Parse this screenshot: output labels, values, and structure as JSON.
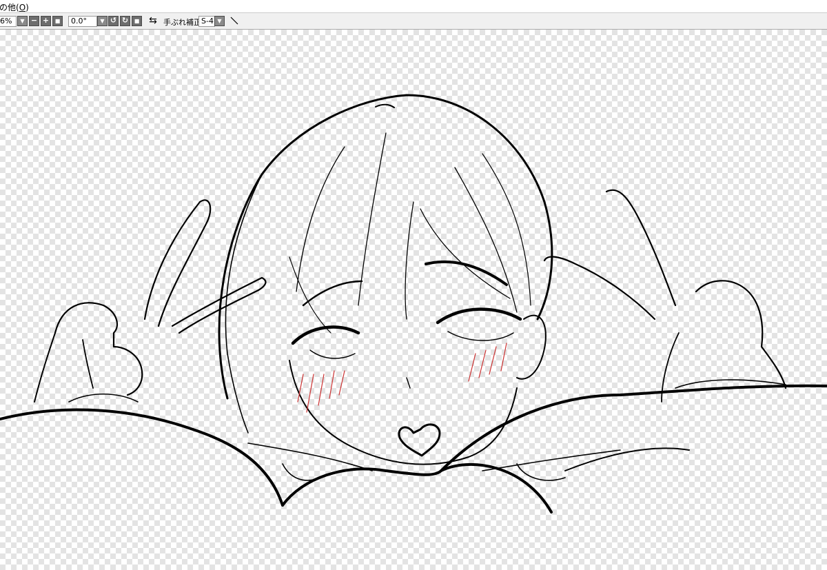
{
  "menubar": {
    "item_prefix": "の他(",
    "item_key": "O",
    "item_suffix": ")"
  },
  "toolbar": {
    "zoom_value": "6%",
    "rotation_value": "0.0°",
    "stabilizer_label": "手ぶれ補正",
    "stabilizer_value": "S-4",
    "dropdown_glyph": "▼",
    "minus_glyph": "−",
    "plus_glyph": "+",
    "rotate_ccw_glyph": "↺",
    "rotate_cw_glyph": "↻",
    "flip_glyph": "⇆",
    "reset_glyph": "■"
  },
  "canvas": {
    "ink_color": "#000000",
    "blush_color": "#cc3333",
    "transparency_color": "#e3e3e3"
  }
}
